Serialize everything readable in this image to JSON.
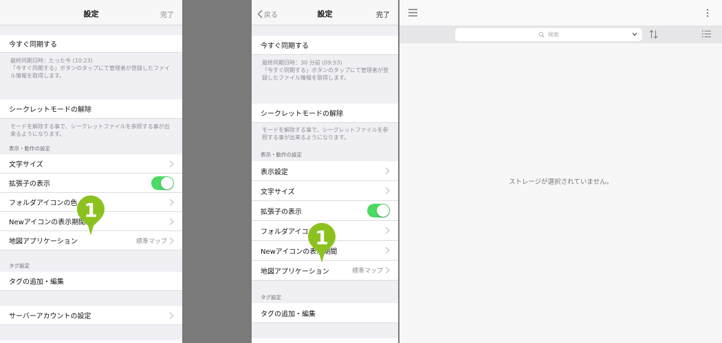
{
  "left": {
    "title": "設定",
    "done": "完了",
    "sync": {
      "label": "今すぐ同期する",
      "note": "最終同期日時：たった今 (10:23)\n「今すぐ同期する」ボタンのタップにて管理者が登録したファイル情報を取得します。"
    },
    "secret": {
      "label": "シークレットモードの解除",
      "note": "モードを解除する事で、シークレットファイルを参照する事が出来るようになります。"
    },
    "display_section": "表示・動作の設定",
    "items": [
      {
        "label": "文字サイズ"
      },
      {
        "label": "拡張子の表示",
        "toggle_on": true
      },
      {
        "label": "フォルダアイコンの色"
      },
      {
        "label": "Newアイコンの表示期間"
      },
      {
        "label": "地図アプリケーション",
        "value": "標準マップ"
      }
    ],
    "tag_section": "タグ設定",
    "tag_item": "タグの追加・編集",
    "server_item": "サーバーアカウントの設定",
    "marker": "1"
  },
  "right": {
    "back": "戻る",
    "title": "設定",
    "done": "完了",
    "sync": {
      "label": "今すぐ同期する",
      "note": "最終同期日時：30 分前 (09:53)\n「今すぐ同期する」ボタンのタップにて管理者が登録したファイル情報を取得します。"
    },
    "secret": {
      "label": "シークレットモードの解除",
      "note": "モードを解除する事で、シークレットファイルを参照する事が出来るようになります。"
    },
    "display_section": "表示・動作の設定",
    "items": [
      {
        "label": "表示設定"
      },
      {
        "label": "文字サイズ"
      },
      {
        "label": "拡張子の表示",
        "toggle_on": true
      },
      {
        "label": "フォルダアイコンの色"
      },
      {
        "label": "Newアイコンの表示期間"
      },
      {
        "label": "地図アプリケーション",
        "value": "標準マップ"
      }
    ],
    "tag_section": "タグ設定",
    "tag_item": "タグの追加・編集",
    "marker": "1"
  },
  "main": {
    "search_placeholder": "検索",
    "empty_message": "ストレージが選択されていません。"
  },
  "colors": {
    "toggle": "#4cd964",
    "marker": "#8cc21f",
    "background": "#7a7a7a"
  },
  "icons": [
    "hamburger-menu-icon",
    "more-vertical-icon",
    "search-icon",
    "chevron-down-icon",
    "sort-icon",
    "list-view-icon",
    "chevron-right-icon",
    "back-chevron-icon"
  ]
}
